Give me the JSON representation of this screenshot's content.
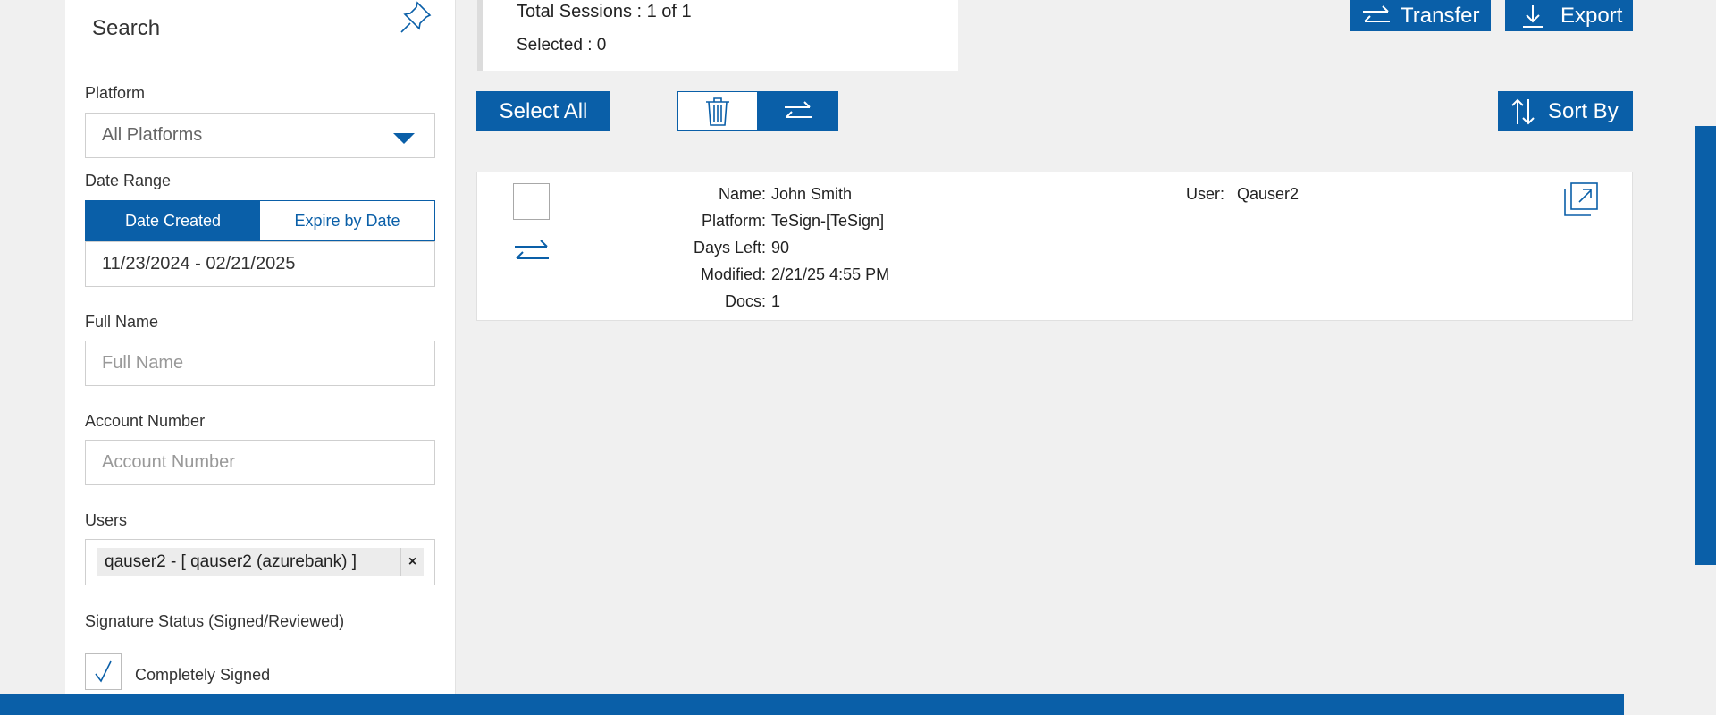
{
  "sidebar": {
    "title": "Search",
    "platform_label": "Platform",
    "platform_value": "All Platforms",
    "date_range_label": "Date Range",
    "date_tabs": [
      "Date Created",
      "Expire by Date"
    ],
    "date_value": "11/23/2024 - 02/21/2025",
    "full_name_label": "Full Name",
    "full_name_placeholder": "Full Name",
    "account_number_label": "Account Number",
    "account_number_placeholder": "Account Number",
    "users_label": "Users",
    "users_tag": "qauser2 - [ qauser2 (azurebank) ]",
    "users_tag_remove": "×",
    "signature_status_label": "Signature Status (Signed/Reviewed)",
    "completely_signed_label": "Completely Signed",
    "completely_signed_checked": true
  },
  "summary": {
    "total_sessions": "Total Sessions : 1 of 1",
    "selected": "Selected : 0"
  },
  "toolbar": {
    "transfer_label": "Transfer",
    "export_label": "Export",
    "select_all_label": "Select All",
    "sort_by_label": "Sort By"
  },
  "session": {
    "name_key": "Name:",
    "name": "John Smith",
    "platform_key": "Platform:",
    "platform": "TeSign-[TeSign]",
    "days_left_key": "Days Left:",
    "days_left": "90",
    "modified_key": "Modified:",
    "modified": "2/21/25 4:55 PM",
    "docs_key": "Docs:",
    "docs": "1",
    "user_key": "User:",
    "user": "Qauser2"
  },
  "colors": {
    "accent": "#0a5fa8",
    "background": "#f0f0f0"
  },
  "icons": [
    "pin-icon",
    "dropdown-caret-icon",
    "checkmark-icon",
    "transfer-icon",
    "export-icon",
    "trash-icon",
    "swap-icon",
    "sort-icon",
    "external-open-icon",
    "remove-icon"
  ]
}
